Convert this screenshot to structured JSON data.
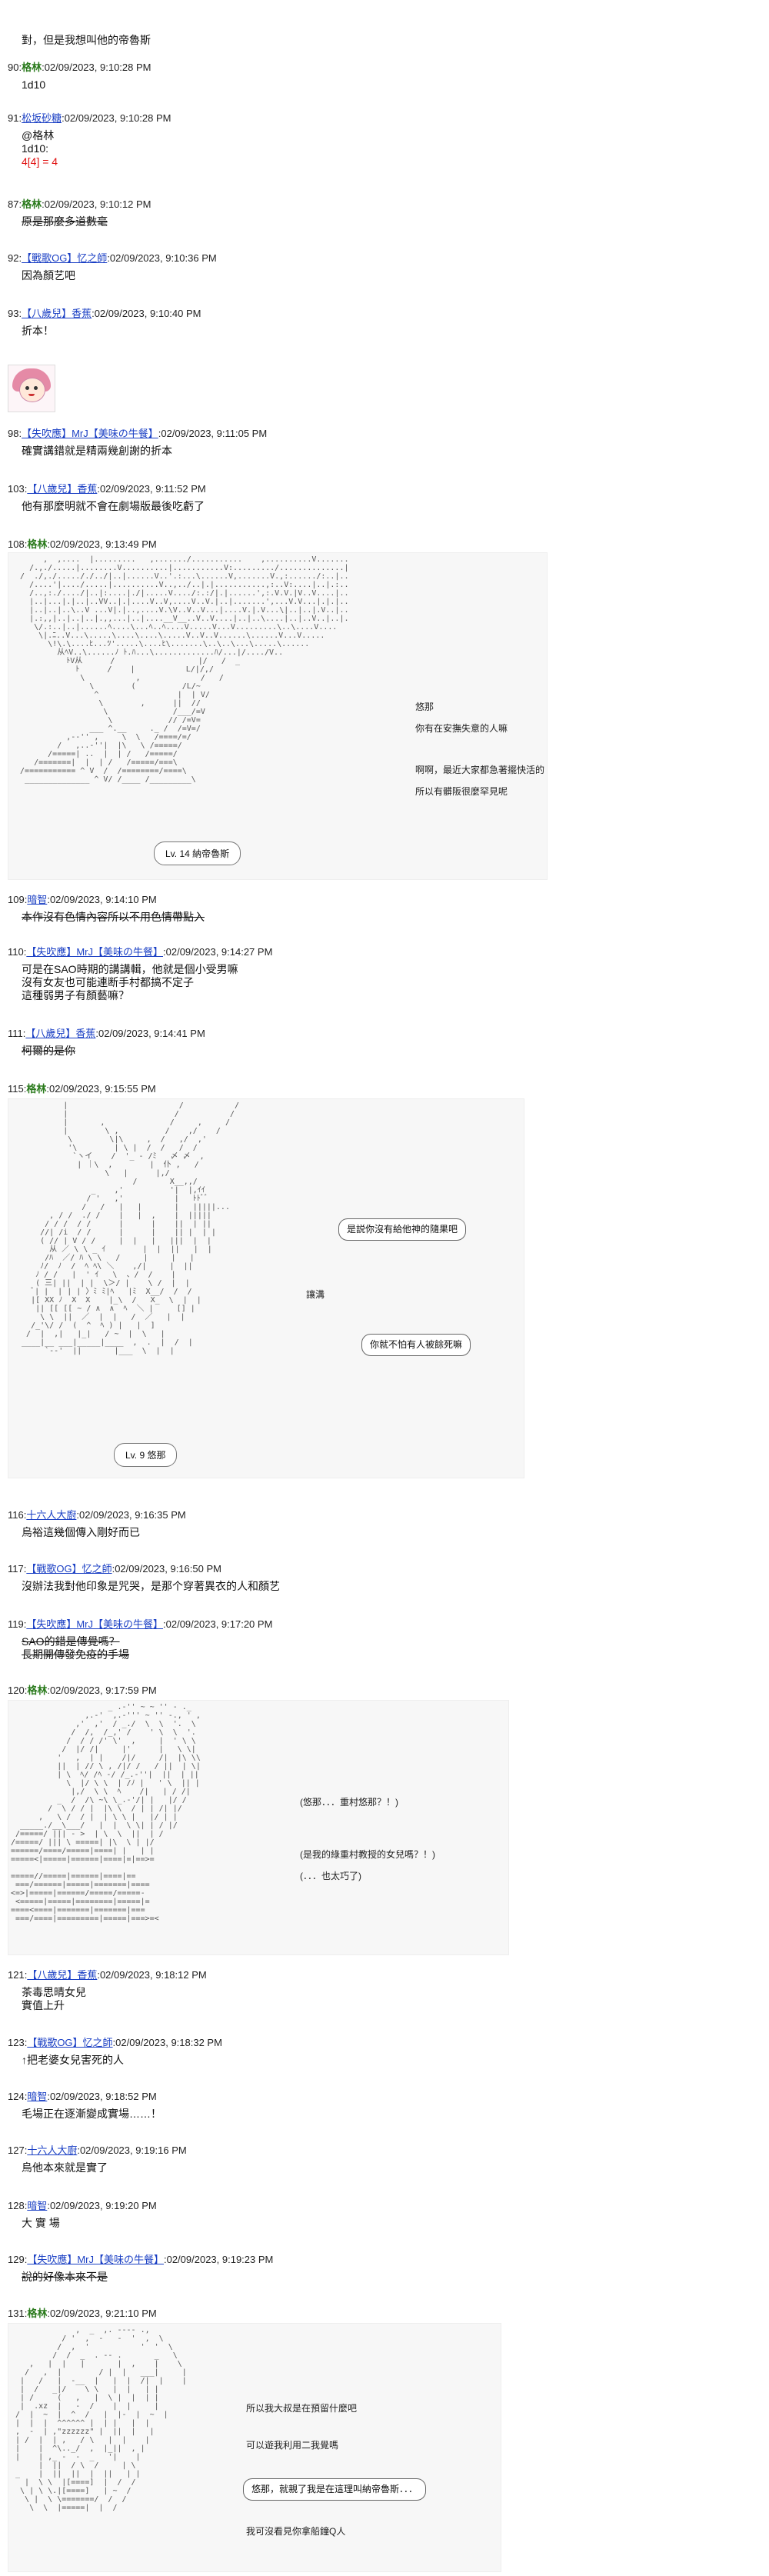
{
  "thread": {
    "top_line": "對，但是我想叫他的帝魯斯",
    "posts": [
      {
        "no": "90:",
        "name": "格林",
        "time": ":02/09/2023, 9:10:28 PM",
        "body": "1d10"
      },
      {
        "no": "91:",
        "name": "松坂砂糖",
        "time": ":02/09/2023, 9:10:28 PM",
        "body": "@格林\n1d10:",
        "dice": "4[4] = 4"
      },
      {
        "no": "87:",
        "name": "格林",
        "time": ":02/09/2023, 9:10:12 PM",
        "body": "原是那麼多道數毫"
      },
      {
        "no": "92:",
        "name": "【戰歌OG】忆之師",
        "time": ":02/09/2023, 9:10:36 PM",
        "body": "因為顏艺吧"
      },
      {
        "no": "93:",
        "name": "【八歲兒】香蕉",
        "time": ":02/09/2023, 9:10:40 PM",
        "body": "折本！"
      },
      {
        "no": "98:",
        "name": "【失吹應】MrJ【美味の牛餐】",
        "time": ":02/09/2023, 9:11:05 PM",
        "body": "確實講錯就是精兩幾創謝的折本"
      },
      {
        "no": "103:",
        "name": "【八歲兒】香蕉",
        "time": ":02/09/2023, 9:11:52 PM",
        "body": "他有那麼明就不會在劇場版最後吃虧了"
      },
      {
        "no": "108:",
        "name": "格林",
        "time": ":02/09/2023, 9:13:49 PM"
      },
      {
        "no": "109:",
        "name": "暗智",
        "time": ":02/09/2023, 9:14:10 PM",
        "body": "本作沒有色情內容所以不用色情帶點入"
      },
      {
        "no": "110:",
        "name": "【失吹應】MrJ【美味の牛餐】",
        "time": ":02/09/2023, 9:14:27 PM",
        "body": "可是在SAO時期的講講輯，他就是個小受男嘛\n沒有女友也可能連断手村都搞不定子\n這種弱男子有顏藝嘛？"
      },
      {
        "no": "111:",
        "name": "【八歲兒】香蕉",
        "time": ":02/09/2023, 9:14:41 PM",
        "body": "柯爾的是你"
      },
      {
        "no": "115:",
        "name": "格林",
        "time": ":02/09/2023, 9:15:55 PM"
      },
      {
        "no": "116:",
        "name": "十六人大廚",
        "time": ":02/09/2023, 9:16:35 PM",
        "body": "烏裕這幾個傳入剛好而已"
      },
      {
        "no": "117:",
        "name": "【戰歌OG】忆之師",
        "time": ":02/09/2023, 9:16:50 PM",
        "body": "沒辦法我對他印象是咒哭，是那个穿著異衣的人和顏艺"
      },
      {
        "no": "119:",
        "name": "【失吹應】MrJ【美味の牛餐】",
        "time": ":02/09/2023, 9:17:20 PM",
        "body": "SAO的錯是傳覺嗎？\n長期開傳發免疫的手場"
      },
      {
        "no": "120:",
        "name": "格林",
        "time": ":02/09/2023, 9:17:59 PM"
      },
      {
        "no": "121:",
        "name": "【八歲兒】香蕉",
        "time": ":02/09/2023, 9:18:12 PM",
        "body": "茶毒思晴女兒\n實值上升"
      },
      {
        "no": "123:",
        "name": "【戰歌OG】忆之師",
        "time": ":02/09/2023, 9:18:32 PM",
        "body": "↑把老婆女兒害死的人"
      },
      {
        "no": "124:",
        "name": "暗智",
        "time": ":02/09/2023, 9:18:52 PM",
        "body": "毛場正在逐漸變成實場……！"
      },
      {
        "no": "127:",
        "name": "十六人大廚",
        "time": ":02/09/2023, 9:19:16 PM",
        "body": "烏他本來就是實了"
      },
      {
        "no": "128:",
        "name": "暗智",
        "time": ":02/09/2023, 9:19:20 PM",
        "body": "大 實 場"
      },
      {
        "no": "129:",
        "name": "【失吹應】MrJ【美味の牛餐】",
        "time": ":02/09/2023, 9:19:23 PM",
        "body": "說的好像本來不是"
      },
      {
        "no": "131:",
        "name": "格林",
        "time": ":02/09/2023, 9:21:10 PM"
      }
    ]
  },
  "scene1": {
    "note1": "悠那",
    "note2": "你有在安撫失意的人嘛",
    "note3": "啊啊，最近大家都急著擺快活的",
    "note4": "所以有髒阪很麼罕見呢",
    "tag": "Lv. 14 納帝魯斯"
  },
  "scene2": {
    "bubble1": "是説你沒有給他神的隨果吧",
    "mid": "讓溝",
    "bubble2": "你就不怕有人被餘死嘛",
    "tag": "Lv. 9 悠那"
  },
  "scene3": {
    "line1": "(悠那．．．重村悠那？！)",
    "line2": "(是我的綠重村教授的女兒嗎？！)",
    "line3": "(．．．也太巧了)"
  },
  "scene4": {
    "line1": "所以我大叔是在預留什麼吧",
    "line2": "可以遊我利用二我覺嗎",
    "bubble": "悠那，就親了我是在這理叫納帝魯斯．．．",
    "line3": "我可沒看見你拿船鐘Q人"
  }
}
